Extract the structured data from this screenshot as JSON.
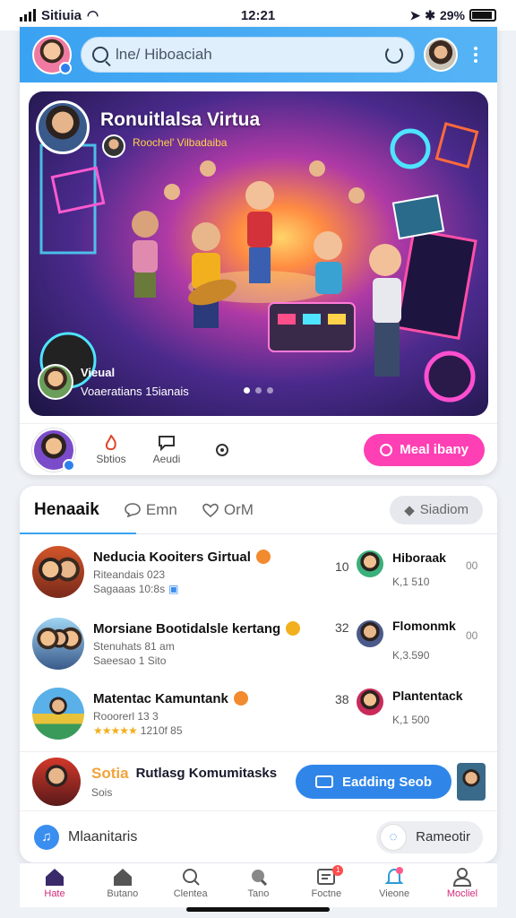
{
  "status": {
    "carrier": "Sitiuia",
    "time": "12:21",
    "battery": "29%"
  },
  "header": {
    "search_value": "lne/ Hiboaciah"
  },
  "hero": {
    "title": "Ronuitlalsa Virtua",
    "subtitle": "Roochel' Vilbadaiba",
    "bottom_line1": "Vieual",
    "bottom_line2": "Voaeratians 15ianais",
    "slide_index": 1,
    "slide_count": 3
  },
  "actions": {
    "items": [
      {
        "label": "Sbtios",
        "icon": "fire-icon"
      },
      {
        "label": "Aeudi",
        "icon": "chat-icon"
      },
      {
        "label": "",
        "icon": "gear-icon"
      }
    ],
    "primary_label": "Meal ibany"
  },
  "tabs": {
    "active": "Henaaik",
    "items": [
      "Emn",
      "OrM"
    ],
    "right_pill": "Siadiom"
  },
  "rows": [
    {
      "title": "Neducia Kooiters Girtual",
      "line2": "Riteandais 023",
      "line3": "Sagaaas 10:8s",
      "num": "10",
      "side_title": "Hiboraak",
      "side_sub": "K,1 510",
      "side_extra": "00",
      "badge_color": "#f28a2e"
    },
    {
      "title": "Morsiane Bootidalsle kertang",
      "line2": "Stenuhats 81 am",
      "line3": "Saeesao 1 Sito",
      "num": "32",
      "side_title": "Flomonmk",
      "side_sub": "K,3.590",
      "side_extra": "00",
      "badge_color": "#f2b01e"
    },
    {
      "title": "Matentac Kamuntank",
      "line2": "Rooorerl 13 3",
      "line3": "1210f 85",
      "stars": "★★★★★",
      "num": "38",
      "side_title": "Plantentack",
      "side_sub": "K,1 500",
      "side_extra": "",
      "badge_color": "#f28a2e"
    }
  ],
  "row4": {
    "brand": "Sotia",
    "title": "Rutlasg Komumitasks",
    "sub": "Sois",
    "button": "Eadding Seob"
  },
  "footer": {
    "label": "Mlaanitaris",
    "pill": "Rameotir"
  },
  "nav": [
    {
      "label": "Hate",
      "icon": "home-icon",
      "active": true
    },
    {
      "label": "Butano",
      "icon": "house-icon"
    },
    {
      "label": "Clentea",
      "icon": "search-icon"
    },
    {
      "label": "Tano",
      "icon": "magnify-icon"
    },
    {
      "label": "Foctne",
      "icon": "inbox-icon",
      "badge": "1"
    },
    {
      "label": "Vieone",
      "icon": "bell-icon"
    },
    {
      "label": "Mocliel",
      "icon": "profile-icon"
    }
  ],
  "colors": {
    "header": "#3aa2f2",
    "accent_pink": "#ff3fb4",
    "accent_blue": "#2f86e8"
  }
}
